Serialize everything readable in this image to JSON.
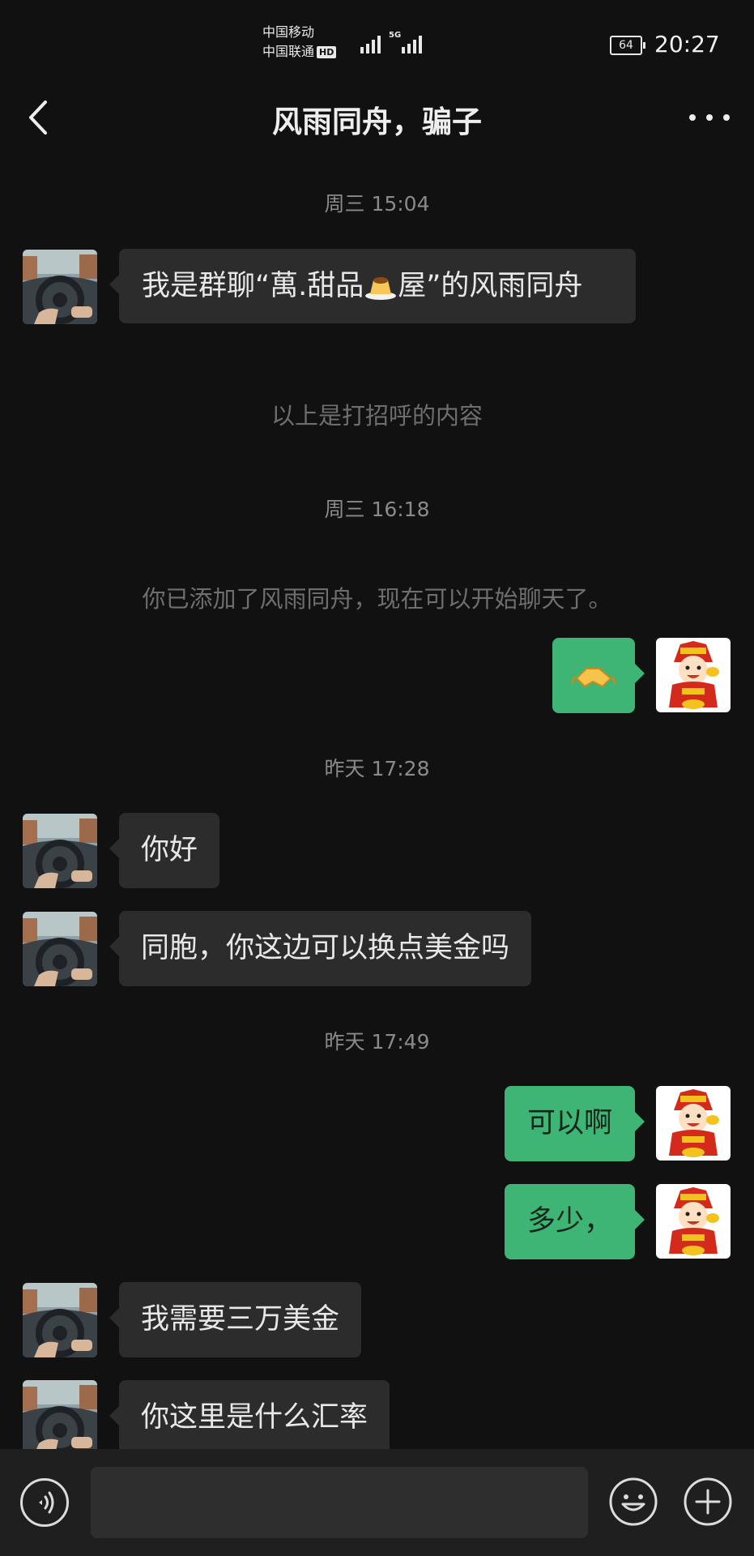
{
  "status_bar": {
    "carrier_1": "中国移动",
    "carrier_2": "中国联通",
    "hd_badge": "HD",
    "network": "5G",
    "battery": "64",
    "time": "20:27"
  },
  "header": {
    "title": "风雨同舟，骗子"
  },
  "messages": {
    "ts_1": "周三 15:04",
    "msg_1_before": "我是群聊“萬.甜品",
    "msg_1_after": "屋”的风雨同舟",
    "sys_1": "以上是打招呼的内容",
    "ts_2": "周三 16:18",
    "sys_2": "你已添加了风雨同舟，现在可以开始聊天了。",
    "msg_2_emoji": "handshake-emoji",
    "ts_3": "昨天 17:28",
    "msg_3": "你好",
    "msg_4": "同胞，你这边可以换点美金吗",
    "ts_4": "昨天 17:49",
    "msg_5": "可以啊",
    "msg_6": "多少，",
    "msg_7": "我需要三万美金",
    "msg_8": "你这里是什么汇率"
  },
  "input_bar": {
    "input_value": ""
  },
  "colors": {
    "background": "#111111",
    "bubble_incoming": "#2c2c2c",
    "bubble_outgoing": "#3eb575",
    "input_bar": "#1f1f1f"
  },
  "icons": {
    "back": "chevron-left-icon",
    "more": "more-dots-icon",
    "voice": "voice-icon",
    "emoji": "emoji-icon",
    "plus": "plus-icon"
  }
}
